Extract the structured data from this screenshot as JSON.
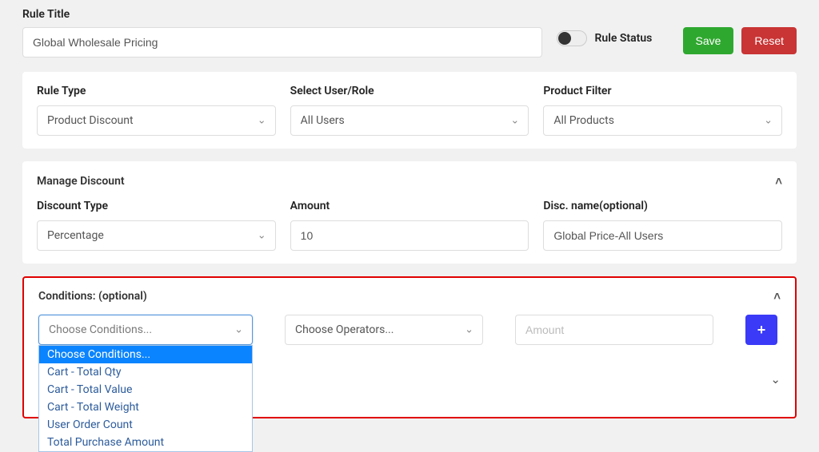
{
  "header": {
    "rule_title_label": "Rule Title",
    "rule_title_value": "Global Wholesale Pricing",
    "rule_status_label": "Rule Status",
    "save_label": "Save",
    "reset_label": "Reset"
  },
  "config": {
    "rule_type_label": "Rule Type",
    "rule_type_value": "Product Discount",
    "user_role_label": "Select User/Role",
    "user_role_value": "All Users",
    "product_filter_label": "Product Filter",
    "product_filter_value": "All Products"
  },
  "discount": {
    "section_title": "Manage Discount",
    "type_label": "Discount Type",
    "type_value": "Percentage",
    "amount_label": "Amount",
    "amount_value": "10",
    "name_label": "Disc. name(optional)",
    "name_value": "Global Price-All Users"
  },
  "conditions": {
    "section_title": "Conditions: (optional)",
    "choose_conditions_placeholder": "Choose Conditions...",
    "choose_operators_placeholder": "Choose Operators...",
    "amount_placeholder": "Amount",
    "options": [
      "Choose Conditions...",
      "Cart - Total Qty",
      "Cart - Total Value",
      "Cart - Total Weight",
      "User Order Count",
      "Total Purchase Amount"
    ],
    "plus_label": "+"
  },
  "glyphs": {
    "chev_down": "⌄",
    "chev_up": "˄"
  }
}
